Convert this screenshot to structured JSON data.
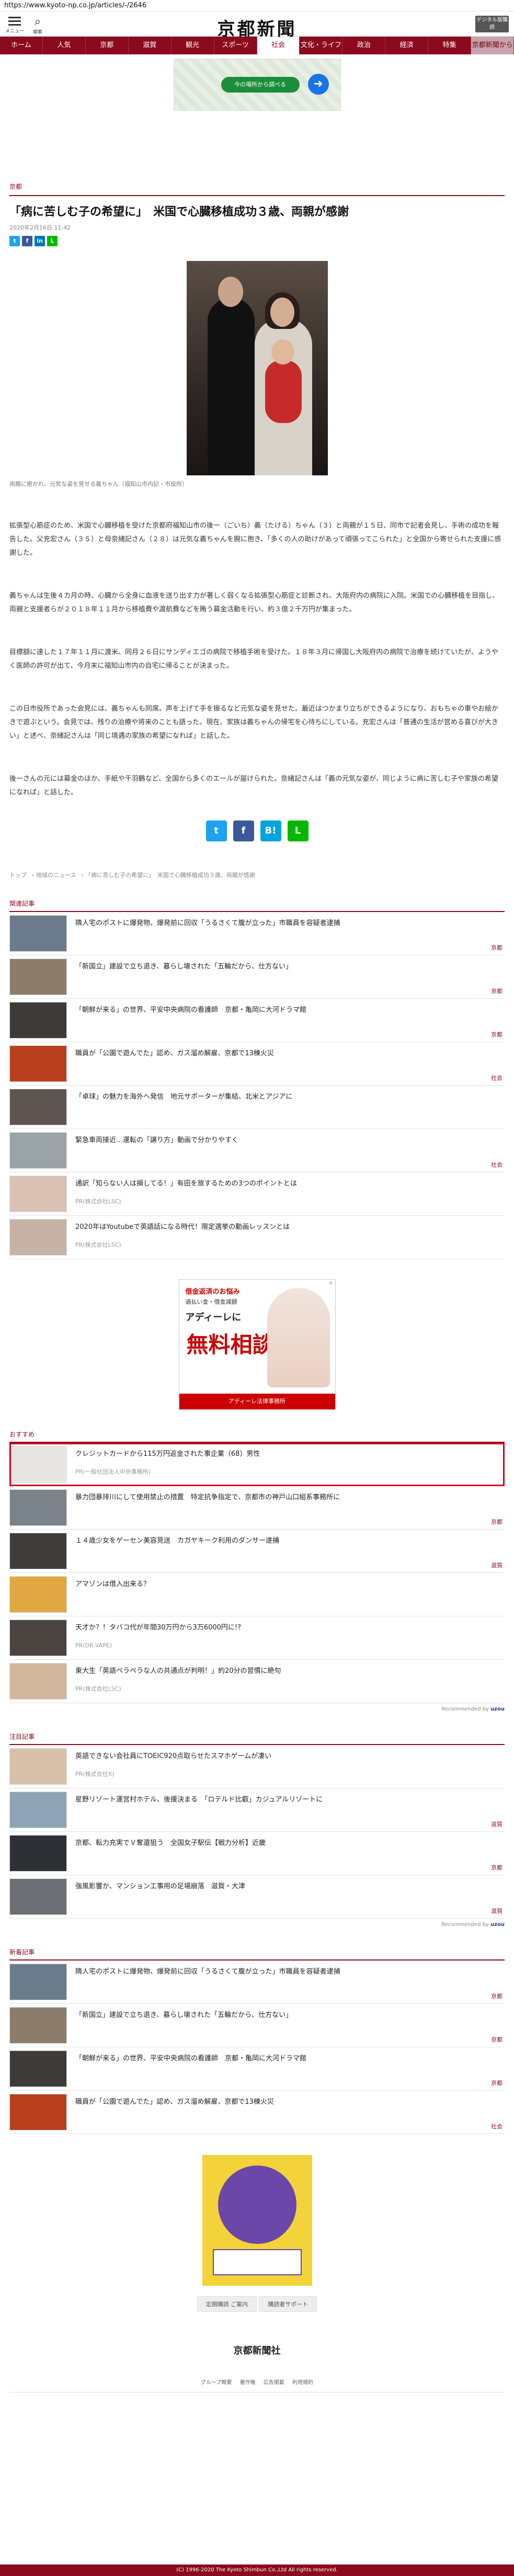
{
  "browser": {
    "url": "https://www.kyoto-np.co.jp/articles/-/2646"
  },
  "header": {
    "menu_label": "メニュー",
    "search_label": "検索",
    "logo": "京都新聞",
    "subscribe_label": "デジタル版購読"
  },
  "nav": [
    "ホーム",
    "人気",
    "京都",
    "滋賀",
    "観光",
    "スポーツ",
    "社会",
    "文化・ライフ",
    "政治",
    "経済",
    "特集",
    "京都新聞から"
  ],
  "top_ad": {
    "button": "今の場所から調べる"
  },
  "article": {
    "section": "京都",
    "title": "「病に苦しむ子の希望に」　米国で心臓移植成功３歳、両親が感謝",
    "date": "2020年2月16日 11:42",
    "caption": "両親に抱かれ、元気な姿を見せる義ちゃん（福知山市内記・市役所）",
    "paragraphs": [
      "拡張型心筋症のため、米国で心臓移植を受けた京都府福知山市の後ー（ごいち）義（たける）ちゃん（３）と両親が１５日、同市で記者会見し、手術の成功を報告した。父充宏さん（３５）と母奈緒記さん（２８）は元気な義ちゃんを腕に抱き、「多くの人の助けがあって頑張ってこられた」と全国から寄せられた支援に感謝した。",
      "義ちゃんは生後４カ月の時、心臓から全身に血液を送り出す力が著しく弱くなる拡張型心筋症と診断され、大阪府内の病院に入院。米国での心臓移植を目指し、両親と支援者らが２０１８年１１月から移植費や渡航費などを賄う募金活動を行い、約３億２千万円が集まった。",
      "目標額に達した１７年１１月に渡米、同月２６日にサンディエゴの病院で移植手術を受けた。１８年３月に帰国し大阪府内の病院で治療を続けていたが、ようやく医師の許可が出て、今月末に福知山市内の自宅に帰ることが決まった。",
      "この日市役所であった会見には、義ちゃんも同席。声を上げて手を振るなど元気な姿を見せた。最近はつかまり立ちができるようになり、おもちゃの車やお絵かきで遊ぶという。会見では、残りの治療や将来のことも語った。現在、家族は義ちゃんの帰宅を心待ちにしている。充宏さんは「普通の生活が営める喜びが大きい」と述べ、奈緒記さんは「同じ境遇の家族の希望になれば」と話した。",
      "後ーさんの元には募金のほか、手紙や千羽鶴など、全国から多くのエールが届けられた。奈緒記さんは「義の元気な姿が、同じように病に苦しむ子や家族の希望になれば」と話した。"
    ],
    "share_mini": [
      "t",
      "f",
      "in",
      "L"
    ],
    "share_big": [
      "t",
      "f",
      "B!",
      "L"
    ]
  },
  "breadcrumbs": [
    "トップ",
    "地域のニュース",
    "「病に苦しむ子の希望に」　米国で心臓移植成功３歳、両親が感謝"
  ],
  "related": {
    "heading": "関連記事",
    "items": [
      {
        "title": "隣人宅のポストに爆発物、爆発前に回収「うるさくて腹が立った」市職員を容疑者逮捕",
        "tag": "京都"
      },
      {
        "title": "「新国立」建設で立ち退き、暮らし壊された「五輪だから、仕方ない」",
        "tag": "京都"
      },
      {
        "title": "「朝鮮が来る」の世界、平安中央病院の看護師　京都・亀岡に大河ドラマ館",
        "tag": "京都"
      },
      {
        "title": "職員が「公園で遊んでた」認め、ガス溜め解雇、京都で13棟火災",
        "tag": "社会"
      },
      {
        "title": "「卓球」の魅力を海外へ発信　地元サポーターが集結、北米とアジアに",
        "tag": ""
      },
      {
        "title": "緊急車両接近…運転の「譲り方」動画で分かりやすく",
        "tag": "社会"
      },
      {
        "title": "通訳「知らない人は損してる！」有田を旅するための3つのポイントとは",
        "tag": "",
        "pr": "PR(株式会社LSC)"
      },
      {
        "title": "2020年はYoutubeで英語話になる時代！限定選挙の動画レッスンとは",
        "tag": "",
        "pr": "PR(株式会社LSC)"
      }
    ]
  },
  "mid_ad": {
    "line1": "借金返済のお悩み",
    "line2": "過払い金・借金減額",
    "line3": "アディーレに",
    "big": "無料相談",
    "bar": "アディーレ法律事務所"
  },
  "recommend": {
    "heading": "おすすめ",
    "items": [
      {
        "title": "クレジットカードから115万円返金された事企業（68）男性",
        "pr": "PR(一般社団法人中央事務所)",
        "highlight": true
      },
      {
        "title": "暴力団暴排川にして使用禁止の措置　特定抗争指定で、京都市の神戸山口組系事務所に",
        "tag": "京都"
      },
      {
        "title": "１４歳少女をゲーセン美容見送　カガヤキーク利用のダンサー遂捕",
        "tag": "滋賀"
      },
      {
        "title": "アマゾンは借入出来る？"
      },
      {
        "title": "天才か？！タバコ代が年間30万円から3万6000円に!?",
        "pr": "PR(DR.VAPE)"
      },
      {
        "title": "東大生「英語ペラペラな人の共通点が判明！」約20分の習慣に絶句",
        "pr": "PR(株式会社LSC)"
      }
    ],
    "credit": "Recommended by",
    "credit_brand": "uzou"
  },
  "featured": {
    "heading": "注目記事",
    "items": [
      {
        "title": "英語できない会社員にTOEIC920点取らせたスマホゲームが凄い",
        "pr": "PR(株式会社X)"
      },
      {
        "title": "星野リゾート運営村ホテル、後援決まる　「ロテルド比叡」カジュアルリゾートに",
        "tag": "滋賀"
      },
      {
        "title": "京都、転力充実でＶ奪還狙う　全国女子駅伝【戦力分析】近畿",
        "tag": "京都"
      },
      {
        "title": "強風影響か、マンション工事用の足場崩落　滋賀・大津",
        "tag": "滋賀"
      }
    ],
    "credit": "Recommended by",
    "credit_brand": "uzou"
  },
  "latest": {
    "heading": "新着記事",
    "items": [
      {
        "title": "隣人宅のポストに爆発物、爆発前に回収「うるさくて腹が立った」市職員を容疑者逮捕",
        "tag": "京都"
      },
      {
        "title": "「新国立」建設で立ち退き、暮らし壊された「五輪だから、仕方ない」",
        "tag": "京都"
      },
      {
        "title": "「朝鮮が来る」の世界、平安中央病院の看護師　京都・亀岡に大河ドラマ館",
        "tag": "京都"
      },
      {
        "title": "職員が「公園で遊んでた」認め、ガス溜め解雇、京都で13棟火災",
        "tag": "社会"
      }
    ]
  },
  "bottom_buttons": [
    "定期購読 ご案内",
    "購読者サポート"
  ],
  "footer": {
    "logo": "京都新聞社",
    "links": [
      "グループ概要",
      "著作権",
      "広告掲載",
      "利用規約"
    ],
    "copyright": "(C) 1996-2020 The Kyoto Shimbun Co.,Ltd All rights reserved."
  }
}
